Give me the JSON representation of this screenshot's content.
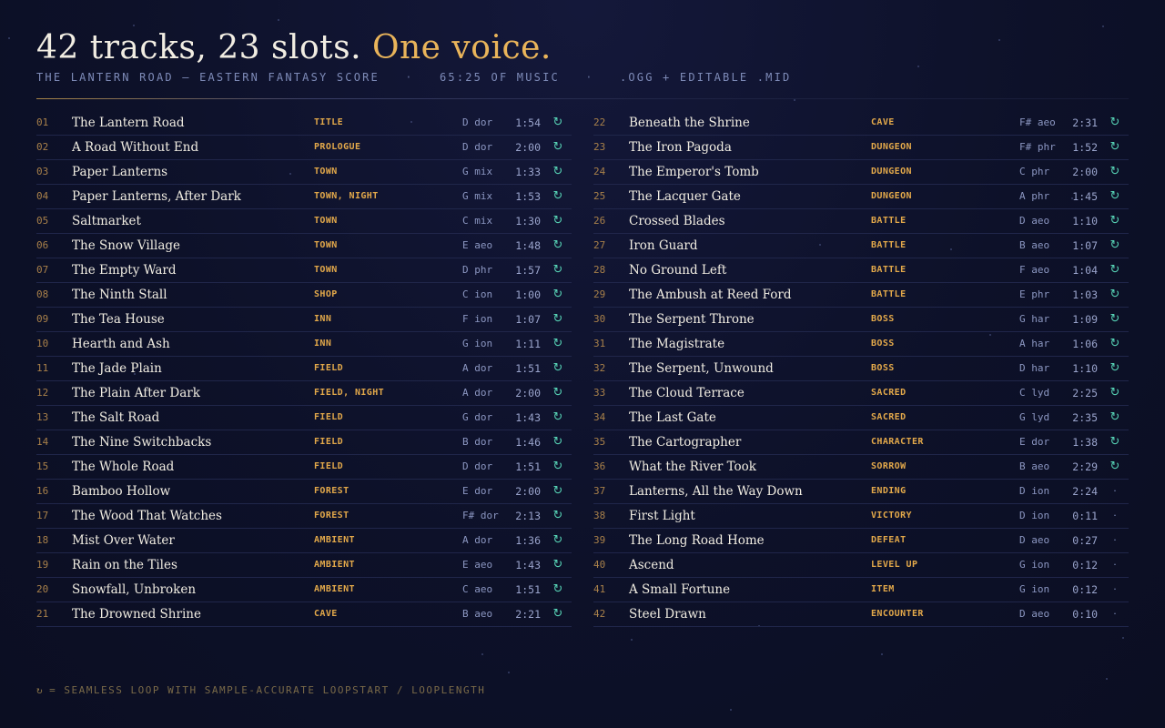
{
  "header": {
    "title_main": "42 tracks, 23 slots.",
    "title_accent": "One voice.",
    "subtitle_name": "THE LANTERN ROAD — EASTERN FANTASY SCORE",
    "subtitle_separator": "·",
    "subtitle_length": "65:25 OF MUSIC",
    "subtitle_formats": ".OGG + EDITABLE .MID"
  },
  "tracks_left": [
    {
      "num": "01",
      "title": "The Lantern Road",
      "tag": "TITLE",
      "key": "D dor",
      "dur": "1:54",
      "loop": "↻"
    },
    {
      "num": "02",
      "title": "A Road Without End",
      "tag": "PROLOGUE",
      "key": "D dor",
      "dur": "2:00",
      "loop": "↻"
    },
    {
      "num": "03",
      "title": "Paper Lanterns",
      "tag": "TOWN",
      "key": "G mix",
      "dur": "1:33",
      "loop": "↻"
    },
    {
      "num": "04",
      "title": "Paper Lanterns, After Dark",
      "tag": "TOWN, NIGHT",
      "key": "G mix",
      "dur": "1:53",
      "loop": "↻"
    },
    {
      "num": "05",
      "title": "Saltmarket",
      "tag": "TOWN",
      "key": "C mix",
      "dur": "1:30",
      "loop": "↻"
    },
    {
      "num": "06",
      "title": "The Snow Village",
      "tag": "TOWN",
      "key": "E aeo",
      "dur": "1:48",
      "loop": "↻"
    },
    {
      "num": "07",
      "title": "The Empty Ward",
      "tag": "TOWN",
      "key": "D phr",
      "dur": "1:57",
      "loop": "↻"
    },
    {
      "num": "08",
      "title": "The Ninth Stall",
      "tag": "SHOP",
      "key": "C ion",
      "dur": "1:00",
      "loop": "↻"
    },
    {
      "num": "09",
      "title": "The Tea House",
      "tag": "INN",
      "key": "F ion",
      "dur": "1:07",
      "loop": "↻"
    },
    {
      "num": "10",
      "title": "Hearth and Ash",
      "tag": "INN",
      "key": "G ion",
      "dur": "1:11",
      "loop": "↻"
    },
    {
      "num": "11",
      "title": "The Jade Plain",
      "tag": "FIELD",
      "key": "A dor",
      "dur": "1:51",
      "loop": "↻"
    },
    {
      "num": "12",
      "title": "The Plain After Dark",
      "tag": "FIELD, NIGHT",
      "key": "A dor",
      "dur": "2:00",
      "loop": "↻"
    },
    {
      "num": "13",
      "title": "The Salt Road",
      "tag": "FIELD",
      "key": "G dor",
      "dur": "1:43",
      "loop": "↻"
    },
    {
      "num": "14",
      "title": "The Nine Switchbacks",
      "tag": "FIELD",
      "key": "B dor",
      "dur": "1:46",
      "loop": "↻"
    },
    {
      "num": "15",
      "title": "The Whole Road",
      "tag": "FIELD",
      "key": "D dor",
      "dur": "1:51",
      "loop": "↻"
    },
    {
      "num": "16",
      "title": "Bamboo Hollow",
      "tag": "FOREST",
      "key": "E dor",
      "dur": "2:00",
      "loop": "↻"
    },
    {
      "num": "17",
      "title": "The Wood That Watches",
      "tag": "FOREST",
      "key": "F# dor",
      "dur": "2:13",
      "loop": "↻"
    },
    {
      "num": "18",
      "title": "Mist Over Water",
      "tag": "AMBIENT",
      "key": "A dor",
      "dur": "1:36",
      "loop": "↻"
    },
    {
      "num": "19",
      "title": "Rain on the Tiles",
      "tag": "AMBIENT",
      "key": "E aeo",
      "dur": "1:43",
      "loop": "↻"
    },
    {
      "num": "20",
      "title": "Snowfall, Unbroken",
      "tag": "AMBIENT",
      "key": "C aeo",
      "dur": "1:51",
      "loop": "↻"
    },
    {
      "num": "21",
      "title": "The Drowned Shrine",
      "tag": "CAVE",
      "key": "B aeo",
      "dur": "2:21",
      "loop": "↻"
    }
  ],
  "tracks_right": [
    {
      "num": "22",
      "title": "Beneath the Shrine",
      "tag": "CAVE",
      "key": "F# aeo",
      "dur": "2:31",
      "loop": "↻"
    },
    {
      "num": "23",
      "title": "The Iron Pagoda",
      "tag": "DUNGEON",
      "key": "F# phr",
      "dur": "1:52",
      "loop": "↻"
    },
    {
      "num": "24",
      "title": "The Emperor's Tomb",
      "tag": "DUNGEON",
      "key": "C phr",
      "dur": "2:00",
      "loop": "↻"
    },
    {
      "num": "25",
      "title": "The Lacquer Gate",
      "tag": "DUNGEON",
      "key": "A phr",
      "dur": "1:45",
      "loop": "↻"
    },
    {
      "num": "26",
      "title": "Crossed Blades",
      "tag": "BATTLE",
      "key": "D aeo",
      "dur": "1:10",
      "loop": "↻"
    },
    {
      "num": "27",
      "title": "Iron Guard",
      "tag": "BATTLE",
      "key": "B aeo",
      "dur": "1:07",
      "loop": "↻"
    },
    {
      "num": "28",
      "title": "No Ground Left",
      "tag": "BATTLE",
      "key": "F aeo",
      "dur": "1:04",
      "loop": "↻"
    },
    {
      "num": "29",
      "title": "The Ambush at Reed Ford",
      "tag": "BATTLE",
      "key": "E phr",
      "dur": "1:03",
      "loop": "↻"
    },
    {
      "num": "30",
      "title": "The Serpent Throne",
      "tag": "BOSS",
      "key": "G har",
      "dur": "1:09",
      "loop": "↻"
    },
    {
      "num": "31",
      "title": "The Magistrate",
      "tag": "BOSS",
      "key": "A har",
      "dur": "1:06",
      "loop": "↻"
    },
    {
      "num": "32",
      "title": "The Serpent, Unwound",
      "tag": "BOSS",
      "key": "D har",
      "dur": "1:10",
      "loop": "↻"
    },
    {
      "num": "33",
      "title": "The Cloud Terrace",
      "tag": "SACRED",
      "key": "C lyd",
      "dur": "2:25",
      "loop": "↻"
    },
    {
      "num": "34",
      "title": "The Last Gate",
      "tag": "SACRED",
      "key": "G lyd",
      "dur": "2:35",
      "loop": "↻"
    },
    {
      "num": "35",
      "title": "The Cartographer",
      "tag": "CHARACTER",
      "key": "E dor",
      "dur": "1:38",
      "loop": "↻"
    },
    {
      "num": "36",
      "title": "What the River Took",
      "tag": "SORROW",
      "key": "B aeo",
      "dur": "2:29",
      "loop": "↻"
    },
    {
      "num": "37",
      "title": "Lanterns, All the Way Down",
      "tag": "ENDING",
      "key": "D ion",
      "dur": "2:24",
      "loop": "·"
    },
    {
      "num": "38",
      "title": "First Light",
      "tag": "VICTORY",
      "key": "D ion",
      "dur": "0:11",
      "loop": "·"
    },
    {
      "num": "39",
      "title": "The Long Road Home",
      "tag": "DEFEAT",
      "key": "D aeo",
      "dur": "0:27",
      "loop": "·"
    },
    {
      "num": "40",
      "title": "Ascend",
      "tag": "LEVEL UP",
      "key": "G ion",
      "dur": "0:12",
      "loop": "·"
    },
    {
      "num": "41",
      "title": "A Small Fortune",
      "tag": "ITEM",
      "key": "G ion",
      "dur": "0:12",
      "loop": "·"
    },
    {
      "num": "42",
      "title": "Steel Drawn",
      "tag": "ENCOUNTER",
      "key": "D aeo",
      "dur": "0:10",
      "loop": "·"
    }
  ],
  "footer": {
    "loop_symbol": "↻",
    "legend_text": "= SEAMLESS LOOP WITH SAMPLE-ACCURATE LOOPSTART / LOOPLENGTH"
  },
  "icons": {
    "loop_icon": "↻",
    "one_shot_icon": "·"
  },
  "colors": {
    "background": "#0d1129",
    "accent_gold": "#e9b45a",
    "tag_orange": "#e2a84a",
    "loop_teal": "#56d1b4",
    "text_primary": "#f1ede2",
    "text_muted": "#7e8bb8"
  }
}
